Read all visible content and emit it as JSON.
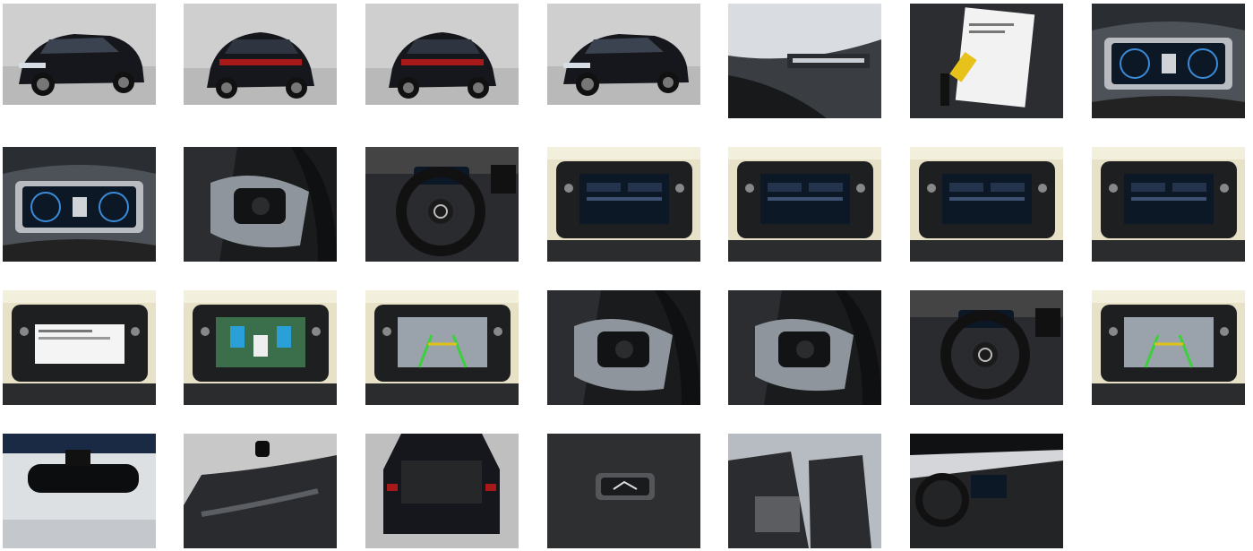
{
  "gallery": {
    "photos": [
      {
        "id": 1,
        "subject": "car-front-left-exterior"
      },
      {
        "id": 2,
        "subject": "car-rear-left-exterior"
      },
      {
        "id": 3,
        "subject": "car-rear-exterior"
      },
      {
        "id": 4,
        "subject": "car-front-exterior"
      },
      {
        "id": 5,
        "subject": "windshield-vin-plate"
      },
      {
        "id": 6,
        "subject": "keys-and-documents"
      },
      {
        "id": 7,
        "subject": "digital-instrument-cluster"
      },
      {
        "id": 8,
        "subject": "digital-instrument-cluster"
      },
      {
        "id": 9,
        "subject": "steering-wheel-controls"
      },
      {
        "id": 10,
        "subject": "steering-wheel-and-dashboard"
      },
      {
        "id": 11,
        "subject": "infotainment-screen"
      },
      {
        "id": 12,
        "subject": "infotainment-screen"
      },
      {
        "id": 13,
        "subject": "infotainment-screen"
      },
      {
        "id": 14,
        "subject": "infotainment-screen"
      },
      {
        "id": 15,
        "subject": "infotainment-service-screen"
      },
      {
        "id": 16,
        "subject": "infotainment-area-view"
      },
      {
        "id": 17,
        "subject": "reversing-camera-screen"
      },
      {
        "id": 18,
        "subject": "steering-wheel-controls"
      },
      {
        "id": 19,
        "subject": "steering-wheel-controls"
      },
      {
        "id": 20,
        "subject": "steering-wheel-and-dashboard"
      },
      {
        "id": 21,
        "subject": "reversing-camera-screen"
      },
      {
        "id": 22,
        "subject": "rear-view-mirror"
      },
      {
        "id": 23,
        "subject": "door-interior-panel"
      },
      {
        "id": 24,
        "subject": "open-trunk"
      },
      {
        "id": 25,
        "subject": "trunk-release-button"
      },
      {
        "id": 26,
        "subject": "rear-seats"
      },
      {
        "id": 27,
        "subject": "front-interior-and-panoramic-roof"
      }
    ]
  },
  "colors": {
    "background": "#ffffff",
    "car_body": "#15171c",
    "studio_wall": "#cfcfcf",
    "dashboard": "#1c1c1e",
    "screen": "#0d1826",
    "trim": "#8f959c"
  }
}
